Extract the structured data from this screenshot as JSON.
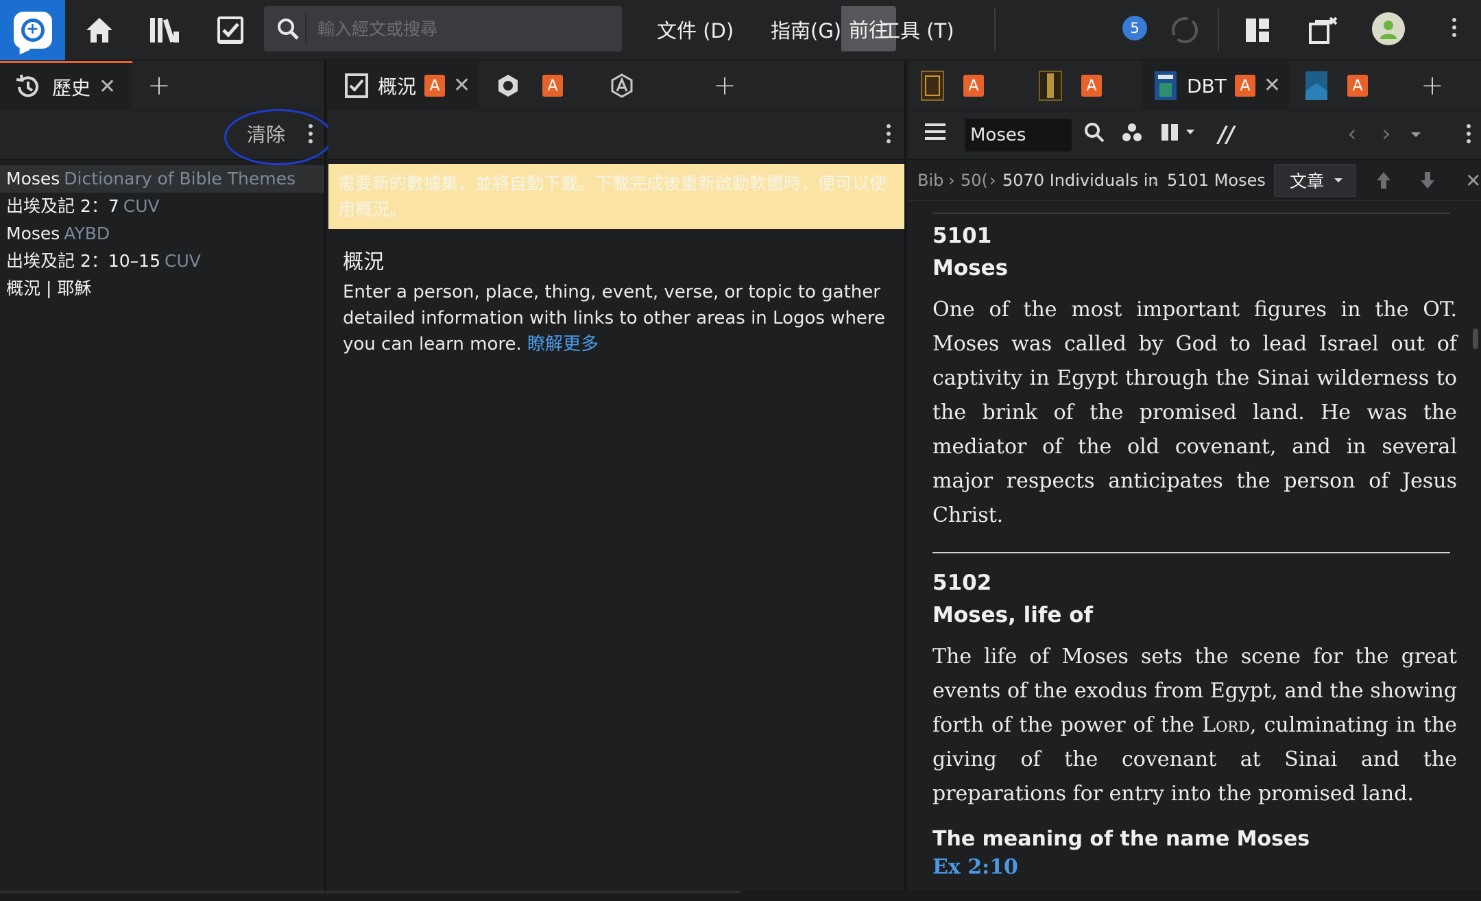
{
  "toolbar": {
    "search_placeholder": "輸入經文或搜尋",
    "go_label": "前往",
    "menus": [
      "文件 (D)",
      "指南(G)",
      "工具 (T)"
    ],
    "notification_count": "5"
  },
  "left_pane": {
    "tab_label": "歷史",
    "clear_label": "清除",
    "history": [
      {
        "main": "Moses",
        "sub": "Dictionary of Bible Themes"
      },
      {
        "main": "出埃及記 2：7",
        "sub": "CUV"
      },
      {
        "main": "Moses",
        "sub": "AYBD"
      },
      {
        "main": "出埃及記 2：10–15",
        "sub": "CUV"
      },
      {
        "main": "概況 | 耶穌",
        "sub": ""
      }
    ]
  },
  "middle_pane": {
    "tabs": [
      {
        "label": "概況",
        "badge": "A"
      },
      {
        "label": "",
        "badge": "A"
      },
      {
        "label": "",
        "badge": ""
      }
    ],
    "notice": "需要新的數據集，並將自動下載。下載完成後重新啟動軟體時，便可以使用概況。",
    "overview_title": "概況",
    "overview_desc": "Enter a person, place, thing, event, verse, or topic to gather detailed information with links to other areas in Logos where you can learn more.",
    "learn_more": "瞭解更多"
  },
  "right_pane": {
    "tabs": [
      {
        "label": "",
        "badge": "A"
      },
      {
        "label": "",
        "badge": "A"
      },
      {
        "label": "DBT",
        "badge": "A"
      },
      {
        "label": "",
        "badge": "A"
      }
    ],
    "search_value": "Moses",
    "breadcrumb": [
      "Bib",
      "50(",
      "5070 Individuals in",
      "5101 Moses"
    ],
    "section_select": "文章",
    "article": {
      "entry1_number": "5101",
      "entry1_title": "Moses",
      "entry1_body": "One of the most important figures in the OT. Moses was called by God to lead Israel out of captivity in Egypt through the Sinai wilderness to the brink of the promised land. He was the mediator of the old covenant, and in several major respects anticipates the person of Jesus Christ.",
      "entry2_number": "5102",
      "entry2_title": "Moses, life of",
      "entry2_body_before": "The life of Moses sets the scene for the great events of the exodus from Egypt, and the showing forth of the power of the ",
      "entry2_body_lord": "Lord",
      "entry2_body_after": ", culminating in the giving of the covenant at Sinai and the preparations for entry into the promised land.",
      "subheading": "The meaning of the name Moses",
      "reference": "Ex 2:10"
    }
  },
  "colors": {
    "accent_blue": "#1b6fd0",
    "badge_orange": "#e8632b",
    "notice_yellow": "#fbe3a4",
    "link_blue": "#4a9ae8",
    "highlight_ring": "#1f3ccf"
  }
}
